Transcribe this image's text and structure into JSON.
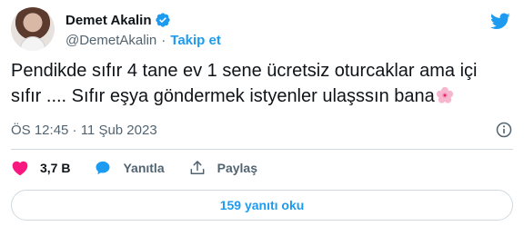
{
  "author": {
    "display_name": "Demet Akalin",
    "handle": "@DemetAkalin",
    "separator": "·",
    "follow_label": "Takip et",
    "verified": true
  },
  "tweet": {
    "line1": "Pendikde sıfır 4 tane ev 1 sene ücretsiz oturcaklar ama içi",
    "line2": "sıfır .... Sıfır eşya göndermek istyenler ulaşssın bana",
    "emoji": "cherry-blossom"
  },
  "meta": {
    "timestamp": "ÖS 12:45 · 11 Şub 2023"
  },
  "actions": {
    "like_count": "3,7 B",
    "reply_label": "Yanıtla",
    "share_label": "Paylaş"
  },
  "replies_button": {
    "label": "159 yanıtı oku"
  },
  "colors": {
    "brand": "#1d9bf0",
    "like": "#f91880",
    "secondary_text": "#536471",
    "border": "#cfd9de"
  }
}
